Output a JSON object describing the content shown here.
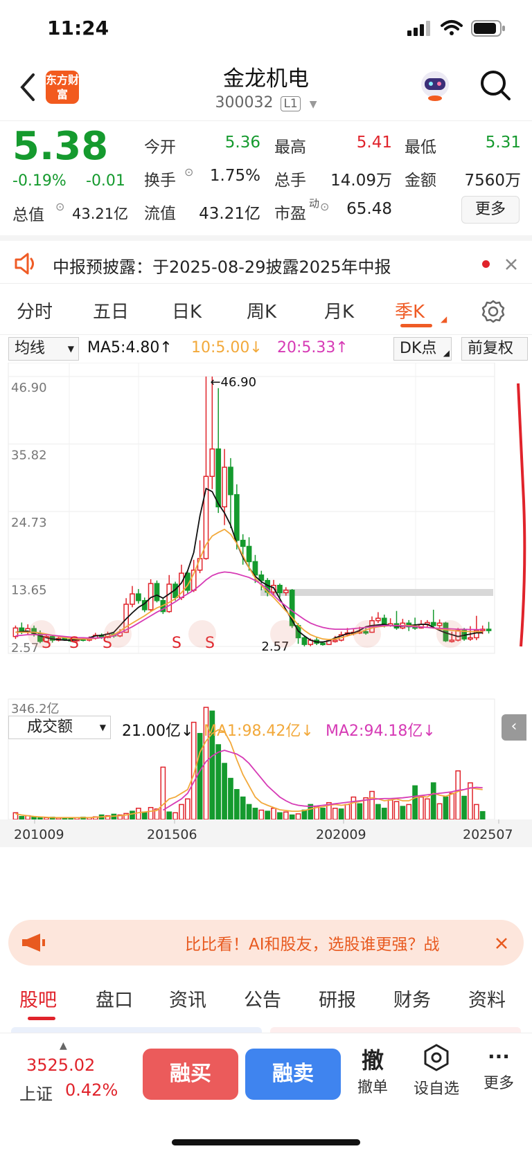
{
  "status_bar": {
    "time": "11:24"
  },
  "header": {
    "title": "金龙机电",
    "code": "300032",
    "level": "L1",
    "logo_text": "东方财富"
  },
  "quote": {
    "price": "5.38",
    "change_pct": "-0.19%",
    "change": "-0.01",
    "open_label": "今开",
    "open": "5.36",
    "high_label": "最高",
    "high": "5.41",
    "low_label": "最低",
    "low": "5.31",
    "turnover_label": "换手",
    "turnover": "1.75%",
    "volume_label": "总手",
    "volume": "14.09万",
    "amount_label": "金额",
    "amount": "7560万",
    "mktcap_label": "总值",
    "mktcap": "43.21亿",
    "float_label": "流值",
    "float_cap": "43.21亿",
    "pe_label": "市盈",
    "pe_sup": "动",
    "pe": "65.48",
    "more_label": "更多"
  },
  "notice": {
    "text": "中报预披露：于2025-08-29披露2025年中报"
  },
  "period_tabs": [
    {
      "label": "分时"
    },
    {
      "label": "五日"
    },
    {
      "label": "日K"
    },
    {
      "label": "周K"
    },
    {
      "label": "月K"
    },
    {
      "label": "季K"
    }
  ],
  "ma_bar": {
    "selector": "均线",
    "ma5": "MA5:4.80↑",
    "ma10": "10:5.00↓",
    "ma20": "20:5.33↑",
    "dk_label": "DK点",
    "adjust_label": "前复权"
  },
  "vol_bar": {
    "selector": "成交额",
    "value": "21.00亿↓",
    "ma1": "MA1:98.42亿↓",
    "ma2": "MA2:94.18亿↓"
  },
  "colors": {
    "up": "#e0232b",
    "down": "#159a2e",
    "ma5": "#111111",
    "ma10": "#f2a93b",
    "ma20": "#d63ab5",
    "accent": "#ef5b25"
  },
  "chart_data": {
    "type": "candlestick",
    "y_ticks": [
      "46.90",
      "35.82",
      "24.73",
      "13.65",
      "2.57"
    ],
    "ylim": [
      2.57,
      46.9
    ],
    "max_label": "46.90",
    "min_label": "2.57",
    "x_ticks": [
      "201009",
      "201506",
      "202009",
      "202507"
    ],
    "volume_top_label": "346.2亿",
    "markers": [
      "S",
      "S",
      "S",
      "S",
      "S"
    ],
    "candles": [
      {
        "o": 4.2,
        "c": 5.6,
        "h": 6.0,
        "l": 3.8
      },
      {
        "o": 5.6,
        "c": 4.9,
        "h": 6.5,
        "l": 4.6
      },
      {
        "o": 4.9,
        "c": 5.5,
        "h": 6.2,
        "l": 4.5
      },
      {
        "o": 5.5,
        "c": 4.7,
        "h": 6.0,
        "l": 4.2
      },
      {
        "o": 4.7,
        "c": 3.4,
        "h": 5.2,
        "l": 3.1
      },
      {
        "o": 3.4,
        "c": 4.2,
        "h": 4.6,
        "l": 3.2
      },
      {
        "o": 4.2,
        "c": 3.6,
        "h": 4.5,
        "l": 3.2
      },
      {
        "o": 3.6,
        "c": 3.9,
        "h": 4.2,
        "l": 3.4
      },
      {
        "o": 3.9,
        "c": 3.7,
        "h": 4.1,
        "l": 3.5
      },
      {
        "o": 3.7,
        "c": 3.5,
        "h": 4.0,
        "l": 3.3
      },
      {
        "o": 3.5,
        "c": 3.8,
        "h": 4.1,
        "l": 3.3
      },
      {
        "o": 3.8,
        "c": 3.6,
        "h": 4.0,
        "l": 3.4
      },
      {
        "o": 3.6,
        "c": 3.9,
        "h": 4.2,
        "l": 3.4
      },
      {
        "o": 3.9,
        "c": 4.4,
        "h": 4.8,
        "l": 3.7
      },
      {
        "o": 4.4,
        "c": 4.1,
        "h": 4.7,
        "l": 3.8
      },
      {
        "o": 4.1,
        "c": 4.6,
        "h": 5.0,
        "l": 3.9
      },
      {
        "o": 4.6,
        "c": 4.3,
        "h": 4.9,
        "l": 4.0
      },
      {
        "o": 4.3,
        "c": 4.9,
        "h": 5.4,
        "l": 4.1
      },
      {
        "o": 4.9,
        "c": 9.5,
        "h": 10.5,
        "l": 4.8
      },
      {
        "o": 9.5,
        "c": 11.2,
        "h": 12.5,
        "l": 9.0
      },
      {
        "o": 11.2,
        "c": 10.1,
        "h": 12.0,
        "l": 9.6
      },
      {
        "o": 10.1,
        "c": 8.6,
        "h": 10.6,
        "l": 8.2
      },
      {
        "o": 8.6,
        "c": 12.9,
        "h": 13.6,
        "l": 8.4
      },
      {
        "o": 12.9,
        "c": 10.1,
        "h": 13.4,
        "l": 9.8
      },
      {
        "o": 10.1,
        "c": 8.3,
        "h": 10.6,
        "l": 7.9
      },
      {
        "o": 8.3,
        "c": 12.8,
        "h": 14.3,
        "l": 8.1
      },
      {
        "o": 12.8,
        "c": 10.6,
        "h": 13.2,
        "l": 10.1
      },
      {
        "o": 10.6,
        "c": 14.6,
        "h": 16.0,
        "l": 10.2
      },
      {
        "o": 14.6,
        "c": 11.8,
        "h": 15.1,
        "l": 11.2
      },
      {
        "o": 11.8,
        "c": 15.1,
        "h": 16.8,
        "l": 11.5
      },
      {
        "o": 15.1,
        "c": 17.0,
        "h": 20.0,
        "l": 14.6
      },
      {
        "o": 17.0,
        "c": 30.5,
        "h": 46.9,
        "l": 16.8
      },
      {
        "o": 30.5,
        "c": 35.0,
        "h": 46.9,
        "l": 28.4
      },
      {
        "o": 35.0,
        "c": 25.5,
        "h": 45.0,
        "l": 24.5
      },
      {
        "o": 25.5,
        "c": 32.0,
        "h": 35.0,
        "l": 22.5
      },
      {
        "o": 32.0,
        "c": 27.5,
        "h": 33.5,
        "l": 22.0
      },
      {
        "o": 27.5,
        "c": 20.0,
        "h": 29.2,
        "l": 18.5
      },
      {
        "o": 20.0,
        "c": 19.0,
        "h": 21.0,
        "l": 16.0
      },
      {
        "o": 19.0,
        "c": 16.5,
        "h": 20.5,
        "l": 15.0
      },
      {
        "o": 16.5,
        "c": 14.3,
        "h": 17.6,
        "l": 13.0
      },
      {
        "o": 14.3,
        "c": 13.4,
        "h": 15.0,
        "l": 11.8
      },
      {
        "o": 13.4,
        "c": 11.5,
        "h": 13.8,
        "l": 10.8
      },
      {
        "o": 11.5,
        "c": 12.6,
        "h": 13.5,
        "l": 11.0
      },
      {
        "o": 12.6,
        "c": 11.4,
        "h": 12.9,
        "l": 10.6
      },
      {
        "o": 11.4,
        "c": 11.8,
        "h": 12.3,
        "l": 10.9
      },
      {
        "o": 11.8,
        "c": 6.0,
        "h": 12.0,
        "l": 5.6
      },
      {
        "o": 6.0,
        "c": 4.0,
        "h": 6.4,
        "l": 3.0
      },
      {
        "o": 4.0,
        "c": 2.9,
        "h": 4.4,
        "l": 2.57
      },
      {
        "o": 2.9,
        "c": 3.6,
        "h": 3.9,
        "l": 2.6
      },
      {
        "o": 3.6,
        "c": 3.1,
        "h": 4.1,
        "l": 2.8
      },
      {
        "o": 3.1,
        "c": 2.9,
        "h": 3.4,
        "l": 2.7
      },
      {
        "o": 2.9,
        "c": 3.5,
        "h": 3.8,
        "l": 2.8
      },
      {
        "o": 3.5,
        "c": 3.6,
        "h": 4.3,
        "l": 3.2
      },
      {
        "o": 3.6,
        "c": 4.5,
        "h": 5.0,
        "l": 3.4
      },
      {
        "o": 4.5,
        "c": 4.8,
        "h": 5.6,
        "l": 4.2
      },
      {
        "o": 4.8,
        "c": 4.9,
        "h": 5.4,
        "l": 4.4
      },
      {
        "o": 4.9,
        "c": 5.0,
        "h": 5.8,
        "l": 4.6
      },
      {
        "o": 5.0,
        "c": 4.9,
        "h": 5.6,
        "l": 4.5
      },
      {
        "o": 4.9,
        "c": 6.8,
        "h": 7.5,
        "l": 4.8
      },
      {
        "o": 6.8,
        "c": 7.2,
        "h": 8.2,
        "l": 6.4
      },
      {
        "o": 7.2,
        "c": 6.0,
        "h": 7.8,
        "l": 5.7
      },
      {
        "o": 6.0,
        "c": 6.3,
        "h": 7.2,
        "l": 5.8
      },
      {
        "o": 6.3,
        "c": 5.6,
        "h": 8.4,
        "l": 5.3
      },
      {
        "o": 5.6,
        "c": 6.4,
        "h": 7.1,
        "l": 5.4
      },
      {
        "o": 6.4,
        "c": 5.8,
        "h": 6.9,
        "l": 5.1
      },
      {
        "o": 5.8,
        "c": 5.6,
        "h": 7.3,
        "l": 5.3
      },
      {
        "o": 5.6,
        "c": 6.2,
        "h": 6.9,
        "l": 5.5
      },
      {
        "o": 6.2,
        "c": 6.5,
        "h": 6.9,
        "l": 5.8
      },
      {
        "o": 6.5,
        "c": 6.0,
        "h": 8.6,
        "l": 5.7
      },
      {
        "o": 6.0,
        "c": 6.4,
        "h": 7.0,
        "l": 5.6
      },
      {
        "o": 6.4,
        "c": 3.5,
        "h": 6.6,
        "l": 3.3
      },
      {
        "o": 3.5,
        "c": 3.6,
        "h": 5.0,
        "l": 3.2
      },
      {
        "o": 3.6,
        "c": 5.2,
        "h": 5.6,
        "l": 3.4
      },
      {
        "o": 5.2,
        "c": 3.8,
        "h": 5.6,
        "l": 3.5
      },
      {
        "o": 3.8,
        "c": 4.0,
        "h": 5.9,
        "l": 3.5
      },
      {
        "o": 4.0,
        "c": 5.2,
        "h": 7.6,
        "l": 3.6
      },
      {
        "o": 5.2,
        "c": 5.4,
        "h": 6.0,
        "l": 4.6
      },
      {
        "o": 5.4,
        "c": 5.38,
        "h": 6.6,
        "l": 4.7
      }
    ],
    "ma5": [
      4.9,
      5.0,
      5.1,
      4.7,
      4.3,
      4.0,
      3.8,
      3.7,
      3.6,
      3.6,
      3.7,
      3.8,
      4.0,
      4.3,
      4.4,
      4.6,
      4.9,
      6.0,
      7.1,
      8.1,
      9.0,
      9.6,
      10.6,
      11.0,
      10.5,
      11.2,
      11.9,
      13.0,
      15.0,
      18.0,
      24.0,
      28.5,
      28.0,
      26.0,
      24.5,
      22.5,
      19.5,
      17.2,
      15.5,
      14.1,
      13.2,
      12.6,
      12.2,
      10.4,
      8.6,
      6.9,
      5.1,
      4.3,
      3.6,
      3.3,
      3.3,
      3.5,
      4.0,
      4.3,
      4.7,
      4.8,
      5.2,
      5.8,
      6.0,
      6.1,
      6.2,
      6.0,
      5.9,
      5.9,
      6.0,
      6.1,
      6.2,
      6.2,
      5.7,
      5.2,
      4.8,
      4.5,
      4.2,
      4.4,
      4.6,
      4.8,
      4.8
    ],
    "ma10": [
      4.9,
      4.9,
      4.9,
      4.9,
      4.8,
      4.6,
      4.4,
      4.2,
      4.0,
      3.9,
      3.8,
      3.8,
      3.8,
      3.9,
      4.0,
      4.2,
      4.5,
      5.1,
      5.8,
      6.4,
      7.0,
      7.6,
      8.3,
      8.9,
      9.3,
      9.8,
      10.4,
      11.4,
      12.6,
      14.5,
      17.0,
      19.3,
      20.7,
      21.3,
      21.8,
      21.0,
      19.5,
      17.5,
      15.5,
      13.8,
      12.6,
      11.5,
      10.6,
      9.5,
      8.4,
      7.3,
      6.1,
      5.2,
      4.5,
      4.1,
      3.8,
      3.7,
      3.8,
      4.0,
      4.3,
      4.6,
      4.9,
      5.3,
      5.6,
      5.8,
      5.9,
      6.0,
      6.0,
      6.0,
      6.0,
      5.9,
      5.8,
      5.7,
      5.6,
      5.4,
      5.3,
      5.2,
      5.1,
      5.05,
      5.0,
      5.0,
      5.0
    ],
    "ma20": [
      4.3,
      4.4,
      4.5,
      4.5,
      4.5,
      4.5,
      4.4,
      4.3,
      4.2,
      4.1,
      4.0,
      4.0,
      3.95,
      3.95,
      4.0,
      4.1,
      4.3,
      4.8,
      5.3,
      5.8,
      6.4,
      7.0,
      7.6,
      8.2,
      8.7,
      9.3,
      9.9,
      10.6,
      11.2,
      11.8,
      12.6,
      13.5,
      14.2,
      14.6,
      14.8,
      14.7,
      14.5,
      14.2,
      13.9,
      13.4,
      12.8,
      12.0,
      11.0,
      10.0,
      9.2,
      8.4,
      7.7,
      7.0,
      6.4,
      6.0,
      5.7,
      5.5,
      5.4,
      5.4,
      5.4,
      5.5,
      5.6,
      5.7,
      5.8,
      5.9,
      6.0,
      6.0,
      6.0,
      5.95,
      5.9,
      5.8,
      5.75,
      5.7,
      5.6,
      5.55,
      5.5,
      5.45,
      5.4,
      5.38,
      5.35,
      5.34,
      5.33
    ],
    "volume": [
      18,
      8,
      10,
      6,
      4,
      5,
      6,
      4,
      5,
      4,
      5,
      6,
      5,
      7,
      12,
      10,
      14,
      12,
      16,
      22,
      30,
      20,
      32,
      28,
      140,
      20,
      18,
      40,
      55,
      260,
      230,
      300,
      290,
      200,
      150,
      110,
      80,
      60,
      40,
      30,
      25,
      22,
      30,
      18,
      20,
      12,
      15,
      25,
      40,
      35,
      30,
      45,
      30,
      28,
      40,
      60,
      42,
      58,
      75,
      40,
      30,
      52,
      48,
      35,
      40,
      90,
      60,
      55,
      98,
      42,
      60,
      70,
      130,
      62,
      98,
      40,
      21
    ],
    "volume_up": [
      1,
      0,
      1,
      0,
      0,
      1,
      0,
      1,
      0,
      0,
      1,
      0,
      1,
      1,
      0,
      1,
      0,
      1,
      1,
      0,
      1,
      0,
      1,
      1,
      1,
      0,
      1,
      1,
      1,
      1,
      0,
      1,
      0,
      0,
      0,
      0,
      0,
      0,
      0,
      0,
      1,
      0,
      1,
      0,
      1,
      0,
      1,
      0,
      0,
      1,
      0,
      1,
      1,
      0,
      1,
      1,
      0,
      1,
      1,
      0,
      0,
      1,
      1,
      0,
      1,
      0,
      1,
      1,
      0,
      1,
      0,
      1,
      1,
      0,
      1,
      1,
      0
    ],
    "volume_ma1": [
      15,
      12,
      10,
      8,
      7,
      6,
      5,
      5,
      5,
      5,
      5,
      5,
      5,
      6,
      7,
      8,
      9,
      10,
      12,
      15,
      18,
      20,
      22,
      24,
      40,
      55,
      60,
      70,
      80,
      120,
      180,
      210,
      230,
      240,
      235,
      205,
      160,
      120,
      90,
      60,
      45,
      38,
      32,
      26,
      24,
      22,
      22,
      24,
      28,
      32,
      34,
      38,
      40,
      38,
      40,
      45,
      48,
      52,
      58,
      55,
      50,
      52,
      55,
      50,
      50,
      58,
      62,
      60,
      70,
      65,
      62,
      68,
      75,
      80,
      85,
      82,
      80
    ],
    "volume_ma2": [
      0,
      0,
      0,
      0,
      0,
      0,
      0,
      0,
      0,
      0,
      0,
      0,
      0,
      0,
      0,
      0,
      0,
      0,
      0,
      0,
      0,
      0,
      0,
      0,
      25,
      35,
      45,
      55,
      70,
      100,
      130,
      155,
      170,
      180,
      185,
      180,
      175,
      165,
      150,
      130,
      110,
      90,
      75,
      60,
      50,
      42,
      38,
      36,
      35,
      36,
      38,
      40,
      42,
      44,
      46,
      48,
      50,
      52,
      54,
      55,
      56,
      56,
      57,
      58,
      60,
      62,
      64,
      66,
      68,
      70,
      72,
      74,
      78,
      80,
      84,
      86,
      85
    ]
  },
  "ai_bar": {
    "text": "比比看！AI和股友，选股谁更强？战"
  },
  "sub_tabs": [
    {
      "label": "股吧"
    },
    {
      "label": "盘口"
    },
    {
      "label": "资讯"
    },
    {
      "label": "公告"
    },
    {
      "label": "研报"
    },
    {
      "label": "财务"
    },
    {
      "label": "资料"
    }
  ],
  "bottom": {
    "index_value": "3525.02",
    "index_name": "上证",
    "index_change": "0.42%",
    "buy_label": "融买",
    "sell_label": "融卖",
    "cancel_icon_text": "撤",
    "cancel_label": "撤单",
    "watch_label": "设自选",
    "more_label": "更多"
  }
}
